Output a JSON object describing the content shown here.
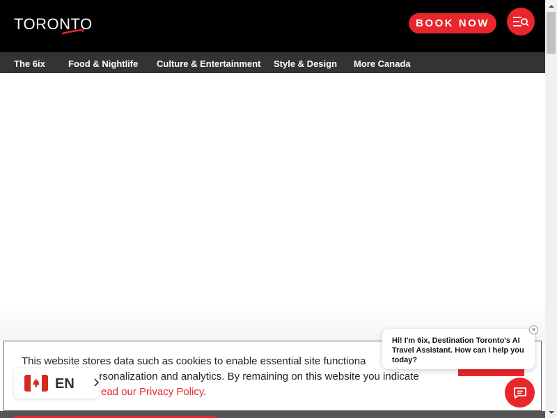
{
  "header": {
    "logo_text": "TORONTO",
    "book_now_label": "BOOK NOW",
    "menu_icon": "menu-search-icon"
  },
  "nav": {
    "items": [
      {
        "label": "The 6ix"
      },
      {
        "label": "Food & Nightlife"
      },
      {
        "label": "Culture & Entertainment"
      },
      {
        "label": "Style & Design"
      },
      {
        "label": "More Canada"
      }
    ]
  },
  "cookie_banner": {
    "line1": "This website stores data such as cookies to enable essential site functiona",
    "line2": "ersonalization and analytics. By remaining on this website you indicate",
    "line3_prefix": "ead our",
    "privacy_link": "Privacy Policy",
    "line3_suffix": "."
  },
  "language": {
    "flag_icon": "canada-flag-icon",
    "label": "EN"
  },
  "chat": {
    "message": "Hi! I'm 6ix, Destination Toronto's AI Travel Assistant. How can I help you today?",
    "close_label": "×"
  },
  "colors": {
    "accent": "#e8262b",
    "header_bg": "#000000",
    "nav_bg": "#333333"
  }
}
